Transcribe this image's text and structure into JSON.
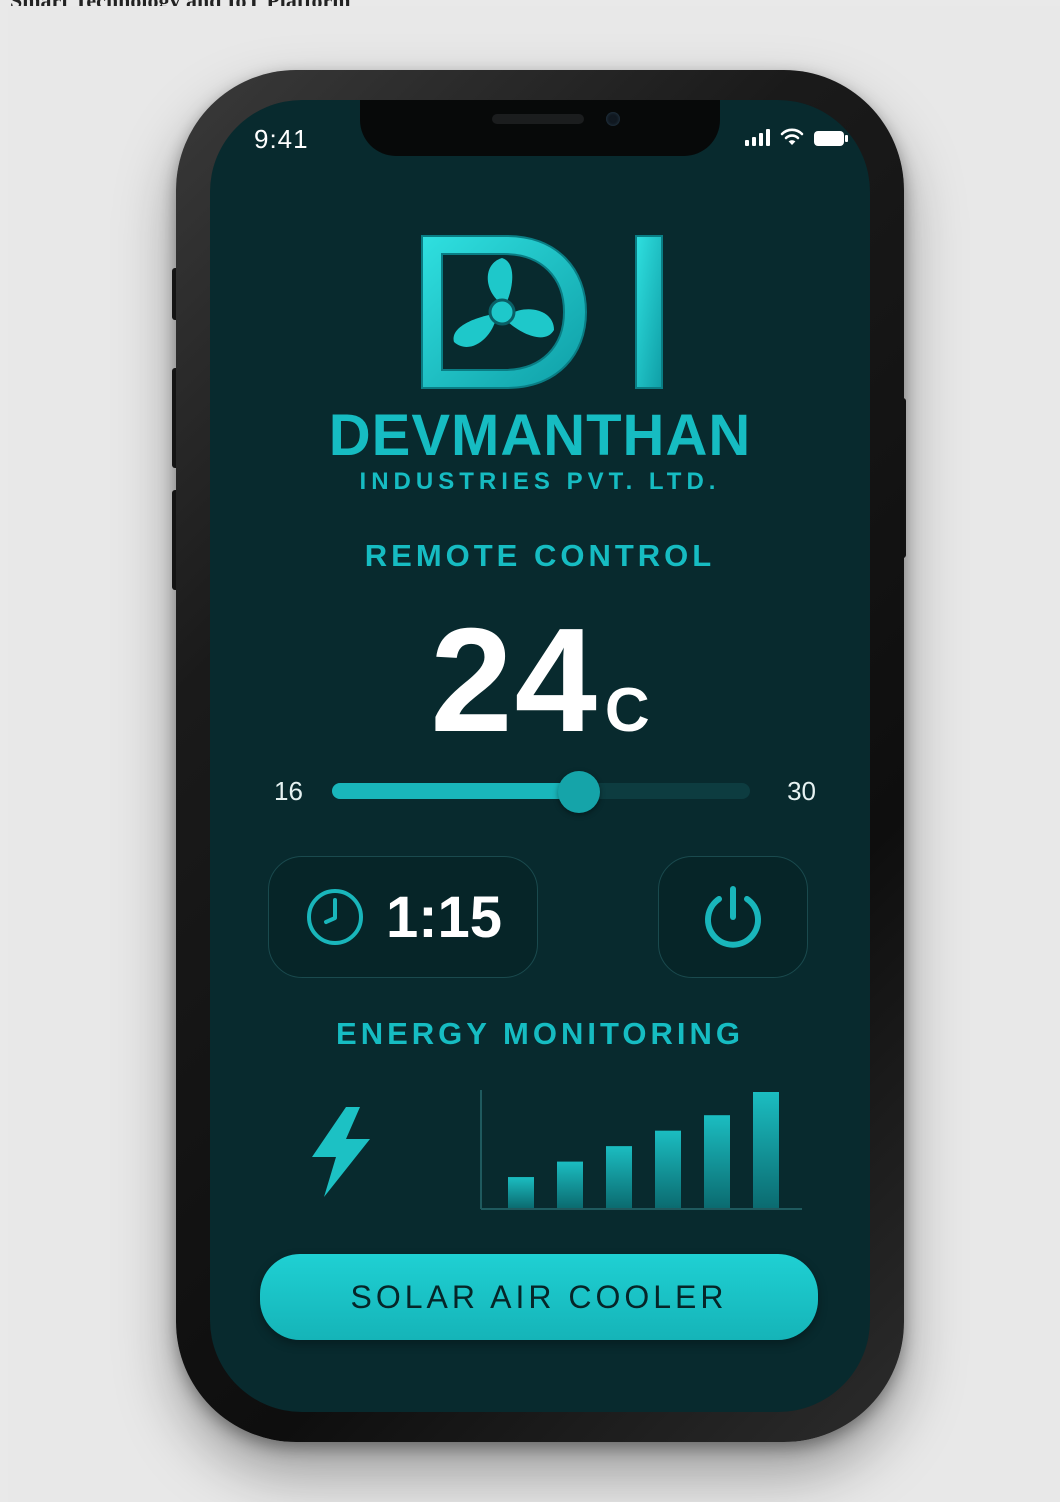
{
  "caption": "Smart Technology and IoT Platform",
  "status_bar": {
    "time": "9:41"
  },
  "brand": {
    "name": "DEVMANTHAN",
    "subtitle": "INDUSTRIES PVT. LTD.",
    "accent_color": "#16bcc2"
  },
  "remote": {
    "title": "REMOTE CONTROL",
    "temperature": "24",
    "unit": "C",
    "slider": {
      "min": "16",
      "max": "30",
      "value": 24
    }
  },
  "timer": {
    "value": "1:15"
  },
  "energy": {
    "title": "ENERGY MONITORING",
    "chart_data": {
      "type": "bar",
      "values": [
        2,
        3,
        4,
        5,
        6,
        7.5
      ]
    }
  },
  "cta": {
    "label": "SOLAR AIR COOLER"
  },
  "icons": [
    "signal-icon",
    "wifi-icon",
    "battery-icon",
    "fan-icon",
    "clock-icon",
    "power-icon",
    "lightning-icon"
  ]
}
